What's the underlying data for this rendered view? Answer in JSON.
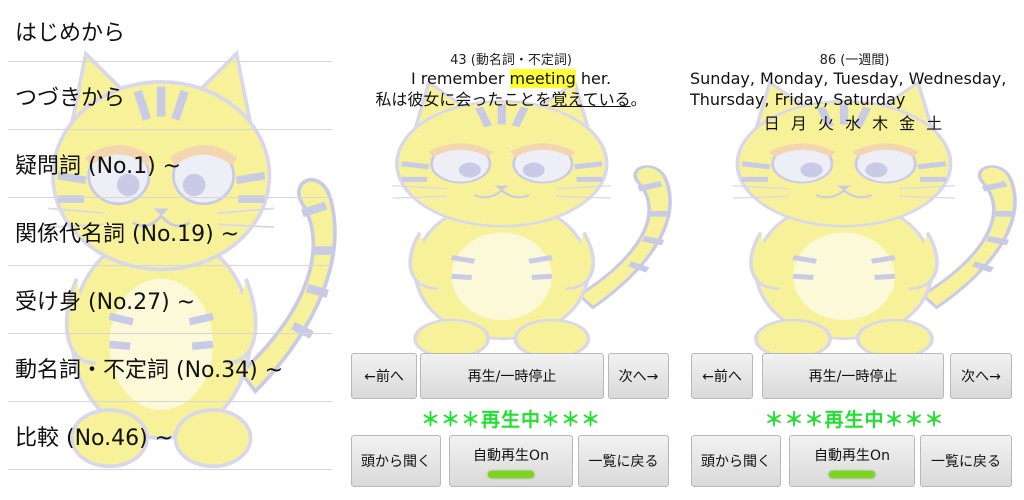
{
  "menu": {
    "items": [
      {
        "label": "はじめから"
      },
      {
        "label": "つづきから"
      },
      {
        "label": "疑問詞 (No.1) ~"
      },
      {
        "label": "関係代名詞 (No.19) ~"
      },
      {
        "label": "受け身 (No.27) ~"
      },
      {
        "label": "動名詞・不定詞 (No.34) ~"
      },
      {
        "label": "比較 (No.46) ~"
      }
    ]
  },
  "player1": {
    "header": "43 (動名詞・不定詞)",
    "en_pre": "I remember ",
    "en_hl": "meeting",
    "en_post": " her.",
    "ja_pre": "私は彼女に会ったことを",
    "ja_ul": "覚えている",
    "ja_post": "。"
  },
  "player2": {
    "header": "86 (一週間)",
    "line1": "Sunday, Monday, Tuesday, Wednesday,",
    "line2": "Thursday, Friday, Saturday",
    "kanji": "日 月 火 水 木 金 土"
  },
  "controls": {
    "prev": "←前へ",
    "playpause": "再生/一時停止",
    "next": "次へ→",
    "status": "＊＊＊再生中＊＊＊",
    "restart": "頭から聞く",
    "autoplay": "自動再生On",
    "back_to_list": "一覧に戻る"
  },
  "colors": {
    "highlight": "#ffff33",
    "status_green": "#22e030",
    "indicator_green": "#7ed321",
    "mascot_yellow": "#f7f29a",
    "mascot_stripe": "#c9cbe6"
  }
}
